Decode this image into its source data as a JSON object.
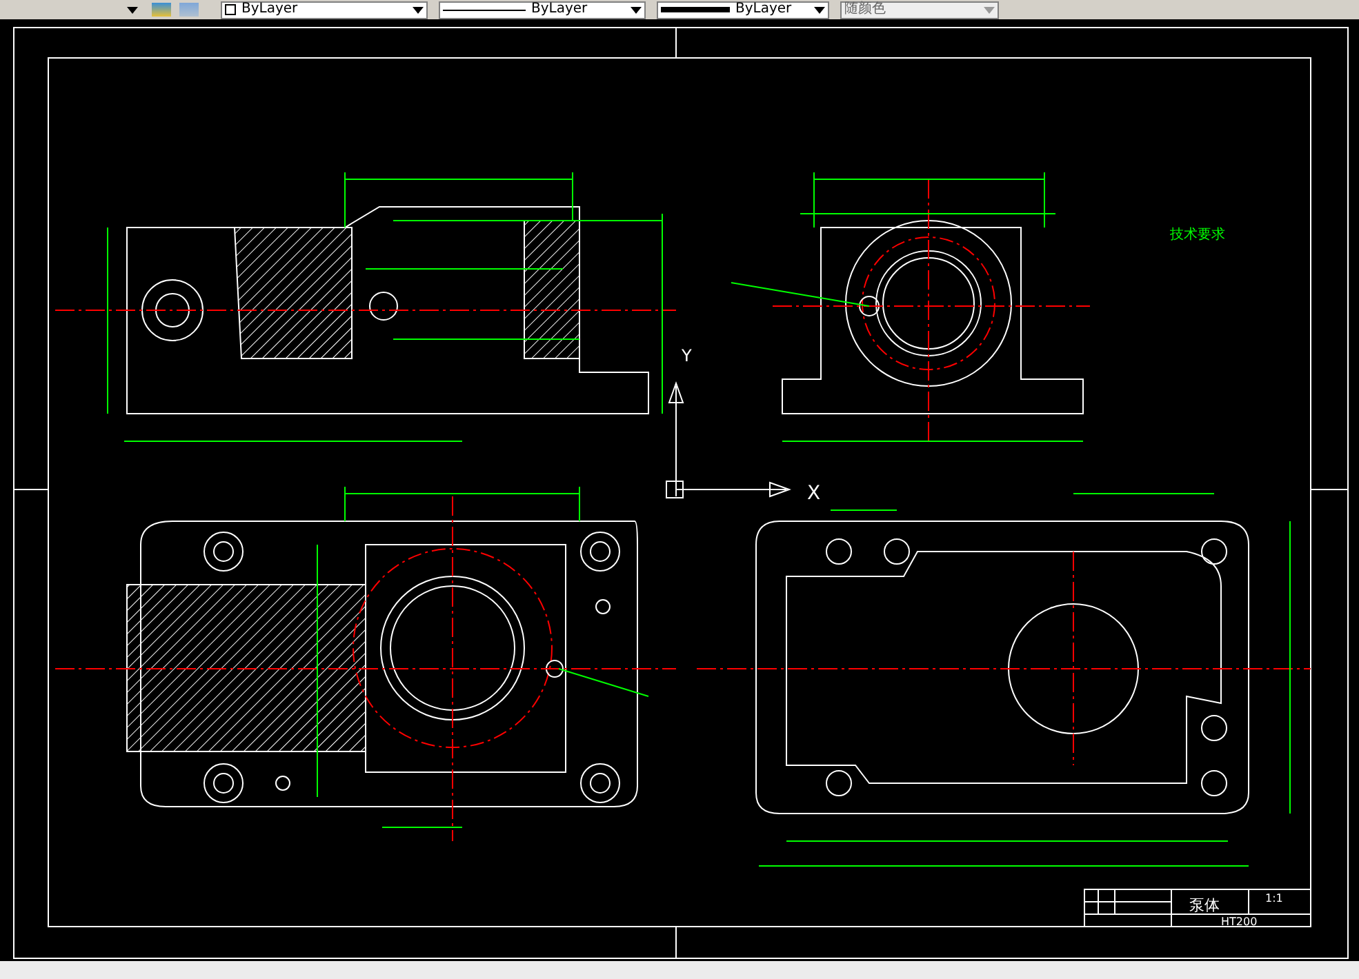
{
  "toolbar": {
    "dropdowns": [
      {
        "kind": "color",
        "value": "ByLayer",
        "disabled": false
      },
      {
        "kind": "linetype",
        "value": "ByLayer",
        "disabled": false
      },
      {
        "kind": "lineweight",
        "value": "ByLayer",
        "disabled": false
      },
      {
        "kind": "plotstyle",
        "value": "随颜色",
        "disabled": true
      }
    ]
  },
  "drawing": {
    "axis_labels": {
      "x": "X",
      "y": "Y"
    },
    "technical_requirements_title": "技术要求",
    "title_block": {
      "part_name": "泵体",
      "scale": "1:1",
      "material": "HT200"
    }
  }
}
